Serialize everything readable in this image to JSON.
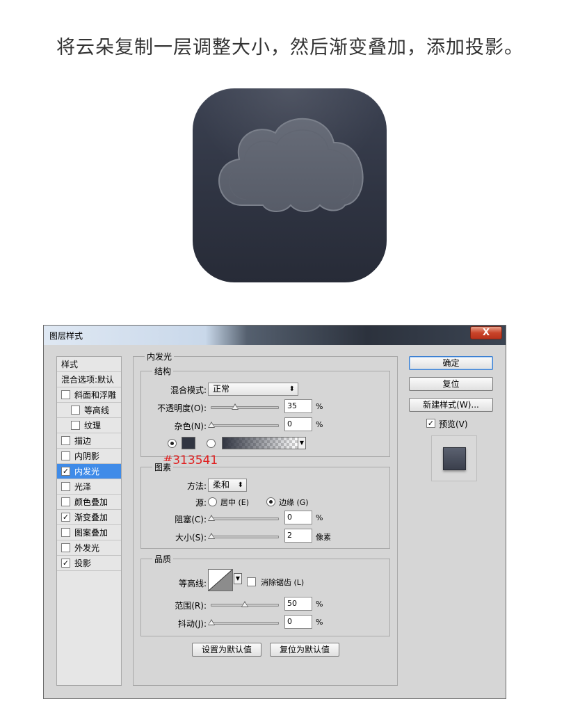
{
  "headline": "将云朵复制一层调整大小，然后渐变叠加，添加投影。",
  "colors": {
    "icon_bg": "#313541",
    "selection": "#3f8be8",
    "annotation": "#e02020"
  },
  "dialog": {
    "title": "图层样式",
    "close_label": "X",
    "sidebar": {
      "header_styles": "样式",
      "header_blend": "混合选项:默认",
      "items": [
        {
          "label": "斜面和浮雕",
          "checked": false
        },
        {
          "label": "等高线",
          "checked": false
        },
        {
          "label": "纹理",
          "checked": false
        },
        {
          "label": "描边",
          "checked": false
        },
        {
          "label": "内阴影",
          "checked": false
        },
        {
          "label": "内发光",
          "checked": true
        },
        {
          "label": "光泽",
          "checked": false
        },
        {
          "label": "颜色叠加",
          "checked": false
        },
        {
          "label": "渐变叠加",
          "checked": true
        },
        {
          "label": "图案叠加",
          "checked": false
        },
        {
          "label": "外发光",
          "checked": false
        },
        {
          "label": "投影",
          "checked": true
        }
      ]
    },
    "panel_title": "内发光",
    "structure": {
      "legend": "结构",
      "blend_mode_label": "混合模式:",
      "blend_mode_value": "正常",
      "opacity_label": "不透明度(O):",
      "opacity_value": "35",
      "opacity_unit": "%",
      "noise_label": "杂色(N):",
      "noise_value": "0",
      "noise_unit": "%",
      "glow_color": "#313541"
    },
    "annotation_text": "#313541",
    "elements": {
      "legend": "图素",
      "technique_label": "方法:",
      "technique_value": "柔和",
      "source_label": "源:",
      "source_center": "居中 (E)",
      "source_edge": "边缘 (G)",
      "choke_label": "阻塞(C):",
      "choke_value": "0",
      "choke_unit": "%",
      "size_label": "大小(S):",
      "size_value": "2",
      "size_unit": "像素"
    },
    "quality": {
      "legend": "品质",
      "contour_label": "等高线:",
      "antialias_label": "消除锯齿 (L)",
      "range_label": "范围(R):",
      "range_value": "50",
      "range_unit": "%",
      "jitter_label": "抖动(J):",
      "jitter_value": "0",
      "jitter_unit": "%"
    },
    "make_default": "设置为默认值",
    "reset_default": "复位为默认值",
    "ok": "确定",
    "reset": "复位",
    "new_style": "新建样式(W)...",
    "preview_label": "预览(V)",
    "preview_checked": true,
    "slider_levels": {
      "opacity": 35,
      "noise": 0,
      "choke": 0,
      "range": 50,
      "jitter": 0
    }
  }
}
